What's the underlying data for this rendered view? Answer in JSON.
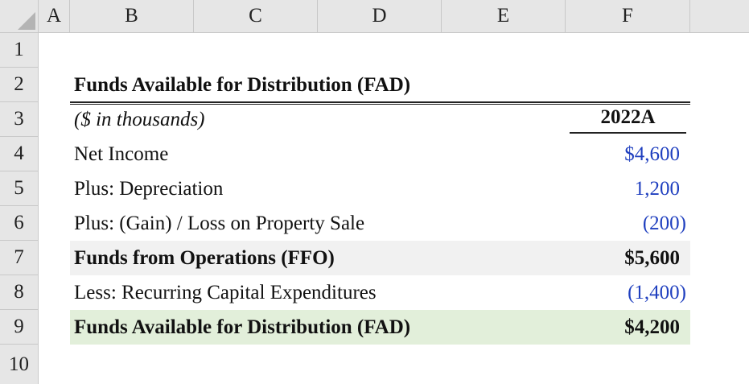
{
  "sheet": {
    "columns": [
      "A",
      "B",
      "C",
      "D",
      "E",
      "F"
    ],
    "rows": [
      "1",
      "2",
      "3",
      "4",
      "5",
      "6",
      "7",
      "8",
      "9",
      "10"
    ]
  },
  "table": {
    "title": "Funds Available for Distribution (FAD)",
    "units": "($ in thousands)",
    "year_header": "2022A",
    "lines": [
      {
        "label": "Net Income",
        "value": "$4,600"
      },
      {
        "label": "Plus: Depreciation",
        "value": "1,200"
      },
      {
        "label": "Plus: (Gain) / Loss on Property Sale",
        "value": "(200)"
      },
      {
        "label": "Funds from Operations (FFO)",
        "value": "$5,600"
      },
      {
        "label": "Less: Recurring Capital Expenditures",
        "value": "(1,400)"
      },
      {
        "label": "Funds Available for Distribution (FAD)",
        "value": "$4,200"
      }
    ]
  },
  "colors": {
    "input_blue": "#1f3fbf",
    "ffo_row_fill": "#f1f1f1",
    "fad_row_fill": "#e2efda",
    "header_fill": "#e6e6e6"
  }
}
